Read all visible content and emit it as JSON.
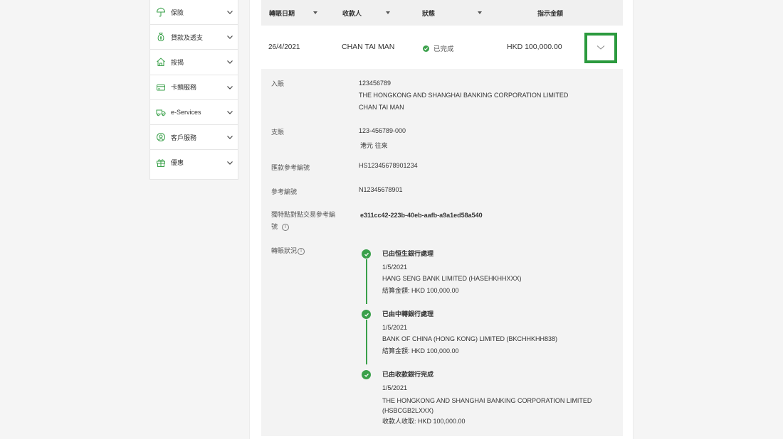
{
  "sidebar": {
    "items": [
      {
        "icon": "umbrella-icon",
        "label": "保險"
      },
      {
        "icon": "money-bag-icon",
        "label": "貸款及透支"
      },
      {
        "icon": "house-icon",
        "label": "按揭"
      },
      {
        "icon": "card-icon",
        "label": "卡類服務"
      },
      {
        "icon": "truck-icon",
        "label": "e-Services"
      },
      {
        "icon": "headset-icon",
        "label": "客戶服務"
      },
      {
        "icon": "gift-icon",
        "label": "優惠"
      }
    ]
  },
  "table": {
    "headers": {
      "date": "轉賬日期",
      "payee": "收款人",
      "status": "狀態",
      "amount": "指示金額"
    },
    "row": {
      "date": "26/4/2021",
      "payee": "CHAN TAI MAN",
      "status": "已完成",
      "amount": "HKD 100,000.00"
    }
  },
  "details": {
    "credit_label": "入賬",
    "credit_account": "123456789",
    "credit_bank": "THE HONGKONG AND SHANGHAI BANKING CORPORATION LIMITED",
    "credit_name": "CHAN TAI MAN",
    "debit_label": "支賬",
    "debit_account": "123-456789-000",
    "debit_type": "港元 往來",
    "remit_ref_label": "匯款參考編號",
    "remit_ref": "HS12345678901234",
    "ref_label": "參考編號",
    "ref": "N12345678901",
    "uetr_label_1": "獨特點對點交易參考編",
    "uetr_label_2": "號",
    "uetr": "e311cc42-223b-40eb-aafb-a9a1ed58a540",
    "status_label": "轉賬狀況",
    "info_glyph": "i"
  },
  "timeline": [
    {
      "title": "已由恒生銀行處理",
      "date": "1/5/2021",
      "bank": "HANG SENG BANK LIMITED (HASEHKHHXXX)",
      "bank_2": "",
      "amount": "結算金額: HKD 100,000.00"
    },
    {
      "title": "已由中轉銀行處理",
      "date": "1/5/2021",
      "bank": "BANK OF CHINA (HONG KONG) LIMITED (BKCHHKHH838)",
      "bank_2": "",
      "amount": "結算金額: HKD 100,000.00"
    },
    {
      "title": "已由收款銀行完成",
      "date": "1/5/2021",
      "bank": "THE HONGKONG AND SHANGHAI BANKING CORPORATION LIMITED",
      "bank_2": "(HSBCGB2LXXX)",
      "amount": "收款人收取: HKD 100,000.00"
    }
  ],
  "colors": {
    "accent_green": "#2b9a3e",
    "success_green": "#3aa04a",
    "icon_green": "#3aa04a"
  }
}
